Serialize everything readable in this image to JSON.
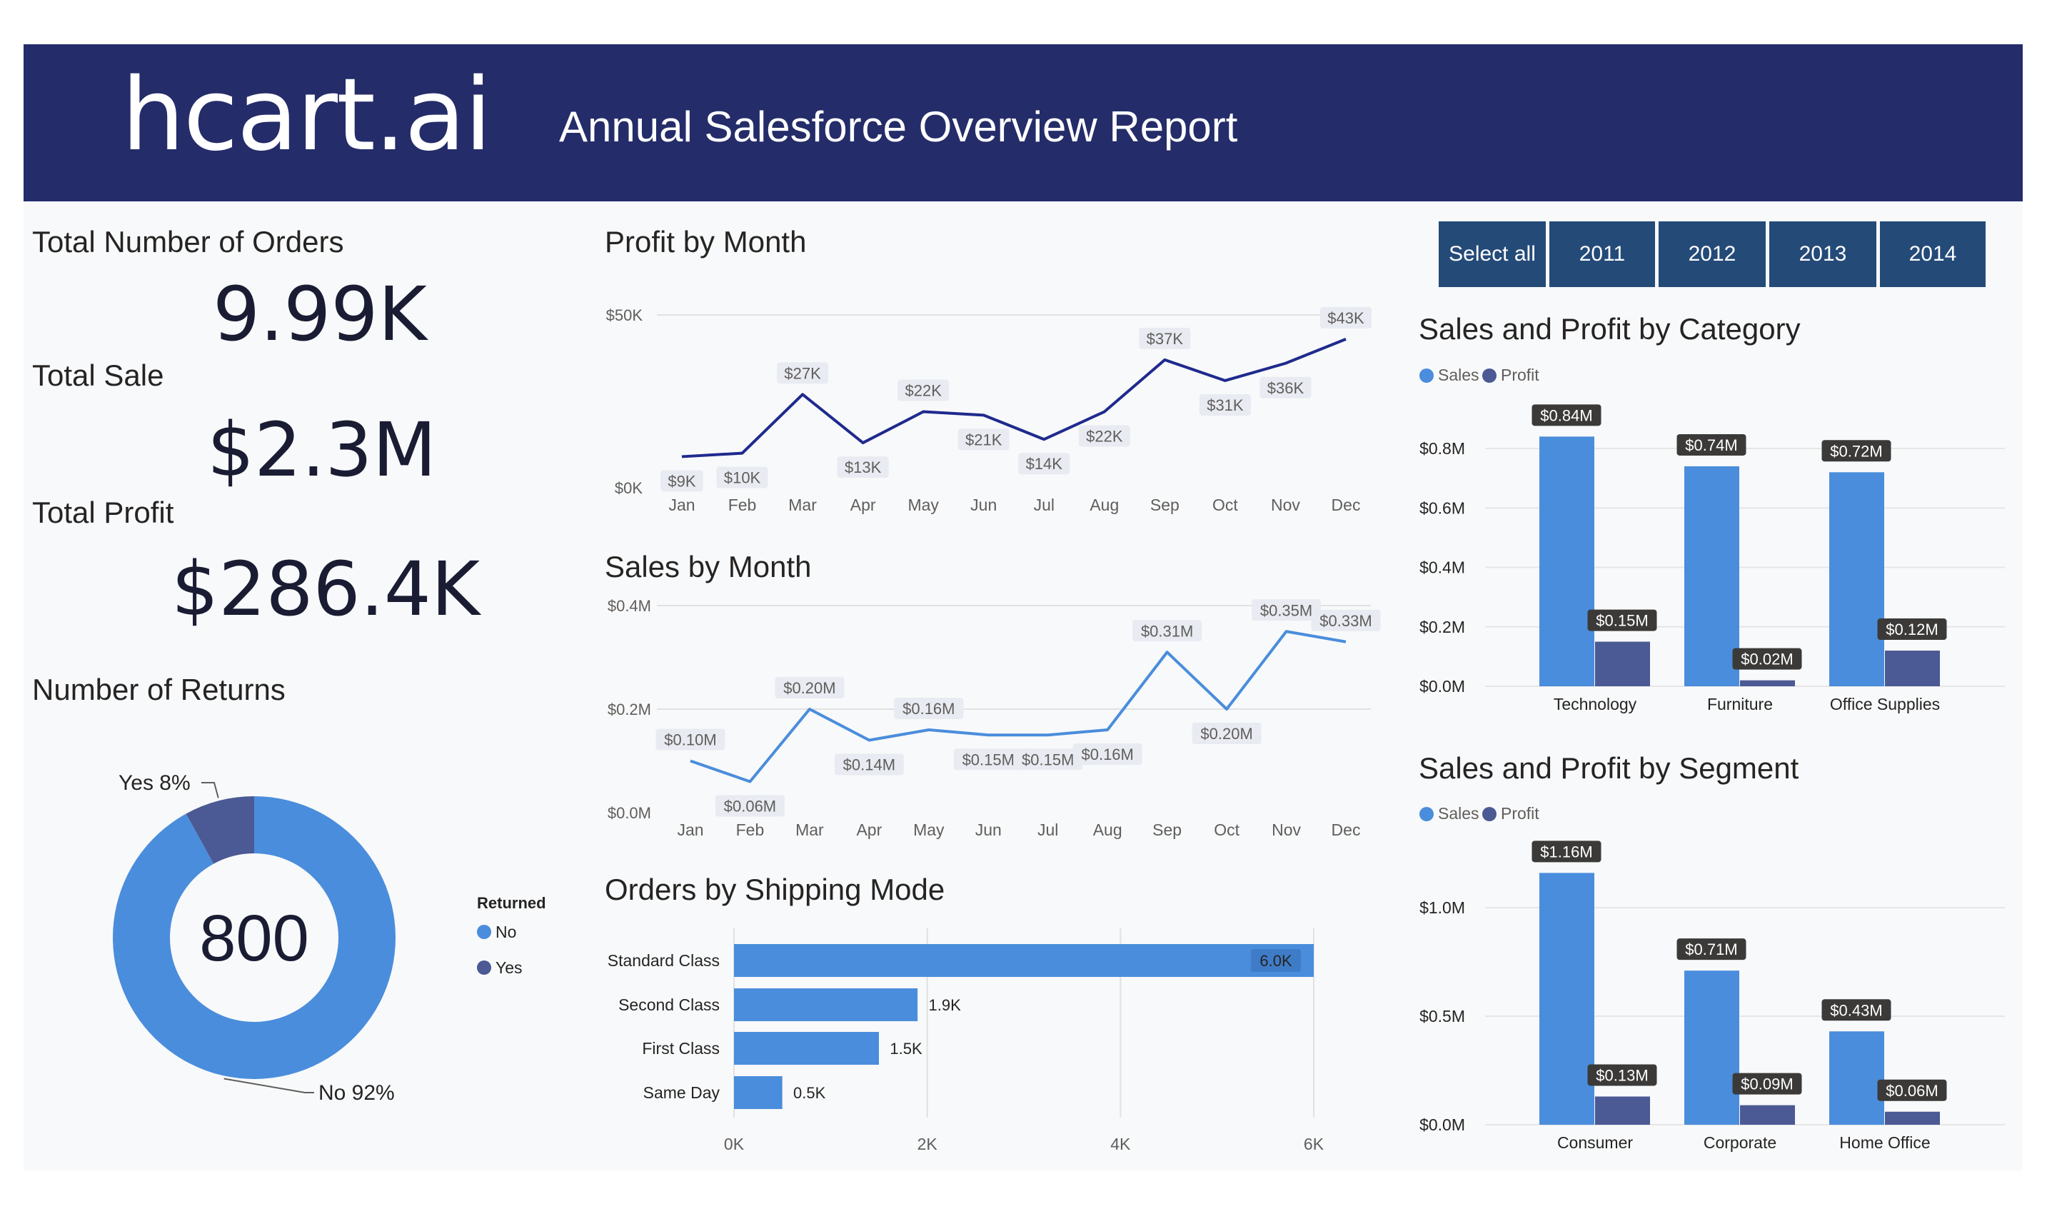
{
  "header": {
    "logo": "hcart.ai",
    "title": "Annual Salesforce Overview Report"
  },
  "kpis": {
    "orders_label": "Total Number of Orders",
    "orders_value": "9.99K",
    "sale_label": "Total Sale",
    "sale_value": "$2.3M",
    "profit_label": "Total Profit",
    "profit_value": "$286.4K"
  },
  "returns": {
    "title": "Number of Returns",
    "center_value": "800",
    "legend_title": "Returned",
    "slices": [
      {
        "label": "No",
        "percent": 92,
        "callout": "No 92%",
        "color": "#4a8ddc"
      },
      {
        "label": "Yes",
        "percent": 8,
        "callout": "Yes 8%",
        "color": "#4b5994"
      }
    ]
  },
  "year_slicer": {
    "options": [
      "Select all",
      "2011",
      "2012",
      "2013",
      "2014"
    ]
  },
  "charts": {
    "profit_month": {
      "title": "Profit by Month",
      "y_ticks": [
        "$50K",
        "$0K"
      ],
      "color": "#1f2a8e"
    },
    "sales_month": {
      "title": "Sales by Month",
      "y_ticks": [
        "$0.4M",
        "$0.2M",
        "$0.0M"
      ],
      "color": "#4a8ddc"
    },
    "shipping": {
      "title": "Orders by Shipping Mode",
      "x_ticks": [
        "0K",
        "2K",
        "4K",
        "6K"
      ],
      "color": "#4a8ddc"
    },
    "category": {
      "title": "Sales and Profit by Category",
      "legend": [
        "Sales",
        "Profit"
      ],
      "y_ticks": [
        "$0.8M",
        "$0.6M",
        "$0.4M",
        "$0.2M",
        "$0.0M"
      ]
    },
    "segment": {
      "title": "Sales and Profit by Segment",
      "legend": [
        "Sales",
        "Profit"
      ],
      "y_ticks": [
        "$1.0M",
        "$0.5M",
        "$0.0M"
      ]
    }
  },
  "colors": {
    "banner": "#242c69",
    "sales": "#4a8ddc",
    "profit": "#4b5994",
    "slicer": "#244a78"
  },
  "chart_data": [
    {
      "type": "line",
      "title": "Profit by Month",
      "categories": [
        "Jan",
        "Feb",
        "Mar",
        "Apr",
        "May",
        "Jun",
        "Jul",
        "Aug",
        "Sep",
        "Oct",
        "Nov",
        "Dec"
      ],
      "values": [
        9,
        10,
        27,
        13,
        22,
        21,
        14,
        22,
        37,
        31,
        36,
        43
      ],
      "labels": [
        "$9K",
        "$10K",
        "$27K",
        "$13K",
        "$22K",
        "$21K",
        "$14K",
        "$22K",
        "$37K",
        "$31K",
        "$36K",
        "$43K"
      ],
      "unit": "K$",
      "ylim": [
        0,
        50
      ]
    },
    {
      "type": "line",
      "title": "Sales by Month",
      "categories": [
        "Jan",
        "Feb",
        "Mar",
        "Apr",
        "May",
        "Jun",
        "Jul",
        "Aug",
        "Sep",
        "Oct",
        "Nov",
        "Dec"
      ],
      "values": [
        0.1,
        0.06,
        0.2,
        0.14,
        0.16,
        0.15,
        0.15,
        0.16,
        0.31,
        0.2,
        0.35,
        0.33
      ],
      "labels": [
        "$0.10M",
        "$0.06M",
        "$0.20M",
        "$0.14M",
        "$0.16M",
        "$0.15M",
        "$0.15M",
        "$0.16M",
        "$0.31M",
        "$0.20M",
        "$0.35M",
        "$0.33M"
      ],
      "unit": "M$",
      "ylim": [
        0,
        0.4
      ]
    },
    {
      "type": "bar",
      "orientation": "horizontal",
      "title": "Orders by Shipping Mode",
      "categories": [
        "Standard Class",
        "Second Class",
        "First Class",
        "Same Day"
      ],
      "values": [
        6.0,
        1.9,
        1.5,
        0.5
      ],
      "labels": [
        "6.0K",
        "1.9K",
        "1.5K",
        "0.5K"
      ],
      "unit": "K",
      "xlim": [
        0,
        6
      ]
    },
    {
      "type": "bar",
      "title": "Sales and Profit by Category",
      "categories": [
        "Technology",
        "Furniture",
        "Office Supplies"
      ],
      "series": [
        {
          "name": "Sales",
          "values": [
            0.84,
            0.74,
            0.72
          ],
          "labels": [
            "$0.84M",
            "$0.74M",
            "$0.72M"
          ]
        },
        {
          "name": "Profit",
          "values": [
            0.15,
            0.02,
            0.12
          ],
          "labels": [
            "$0.15M",
            "$0.02M",
            "$0.12M"
          ]
        }
      ],
      "unit": "M$",
      "ylim": [
        0,
        0.8
      ]
    },
    {
      "type": "bar",
      "title": "Sales and Profit by Segment",
      "categories": [
        "Consumer",
        "Corporate",
        "Home Office"
      ],
      "series": [
        {
          "name": "Sales",
          "values": [
            1.16,
            0.71,
            0.43
          ],
          "labels": [
            "$1.16M",
            "$0.71M",
            "$0.43M"
          ]
        },
        {
          "name": "Profit",
          "values": [
            0.13,
            0.09,
            0.06
          ],
          "labels": [
            "$0.13M",
            "$0.09M",
            "$0.06M"
          ]
        }
      ],
      "unit": "M$",
      "ylim": [
        0,
        1.0
      ]
    }
  ]
}
